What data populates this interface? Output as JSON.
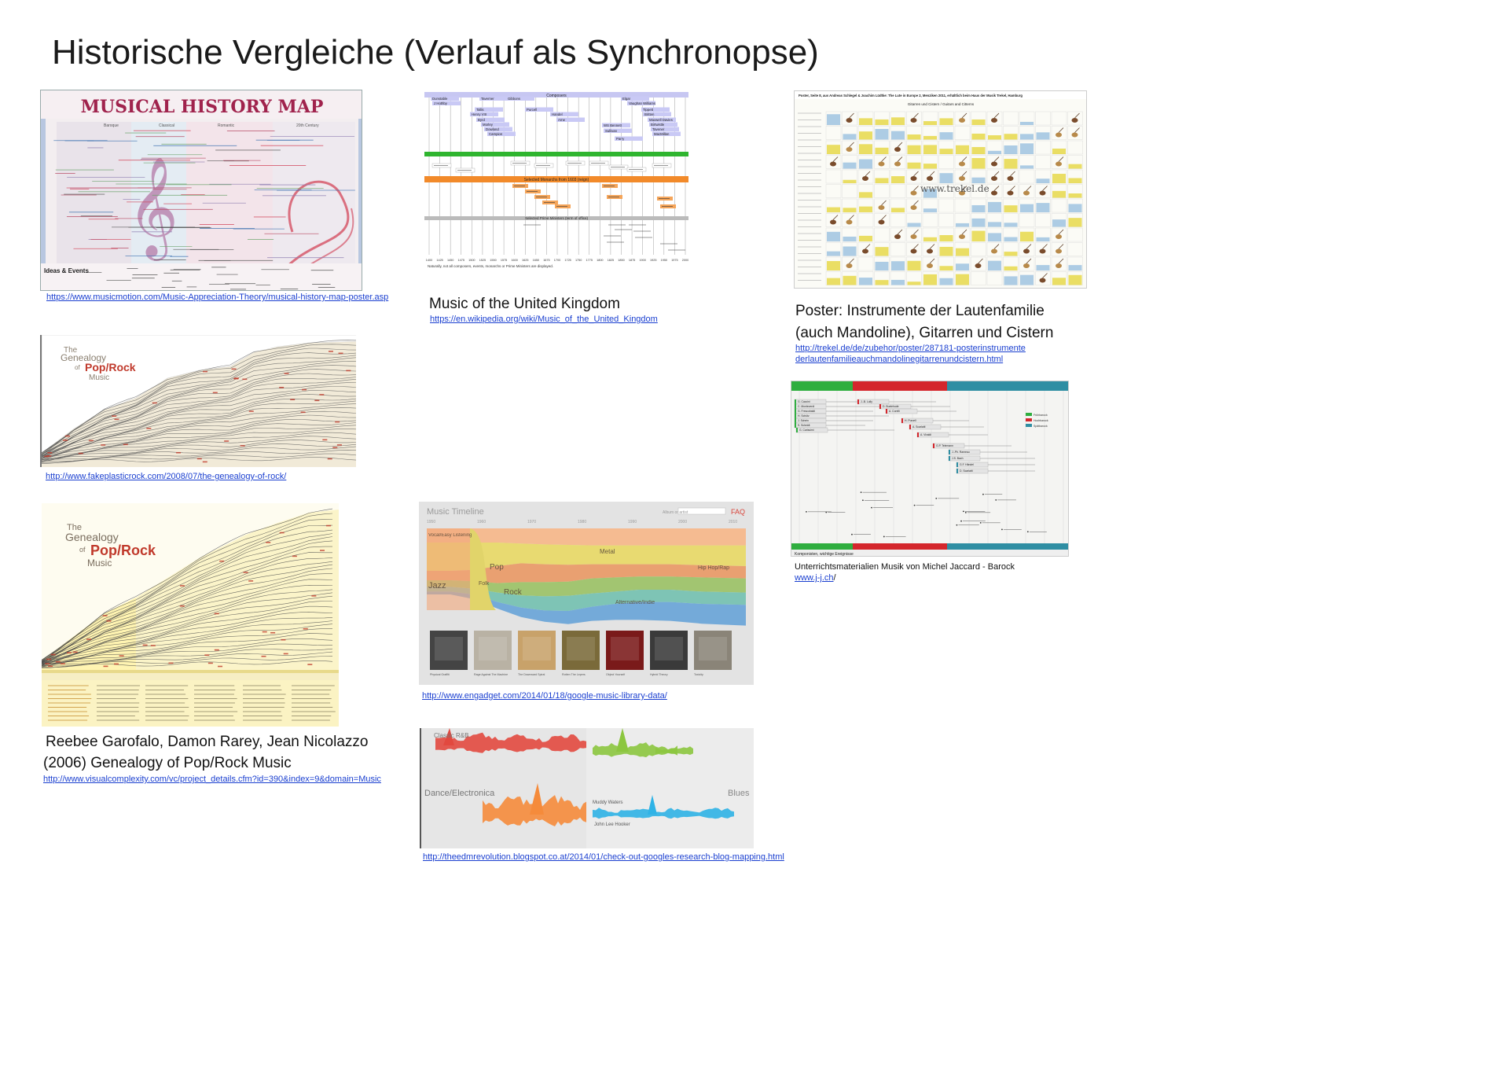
{
  "page": {
    "title": "Historische Vergleiche (Verlauf als Synchronopse)"
  },
  "items": {
    "musical_history_map": {
      "poster_title": "MUSICAL HISTORY MAP",
      "eras": [
        "Baroque",
        "Classical",
        "Romantic",
        "20th Century"
      ],
      "ideas_label": "Ideas & Events",
      "link": "https://www.musicmotion.com/Music-Appreciation-Theory/musical-history-map-poster.asp"
    },
    "music_uk": {
      "header_composers": "Composers",
      "header_monarchs": "Selected Monarchs from 1603 (reign)",
      "header_ministers": "Selected Prime Ministers (term of office)",
      "composers": [
        "Dunstable",
        "J Hothby",
        "Taverner",
        "Tallis",
        "Henry VIII",
        "Byrd",
        "Morley",
        "Dowland",
        "Campion",
        "Gibbons",
        "Purcell",
        "Handel",
        "Arne",
        "Elgar",
        "Vaughan Williams",
        "Tippett",
        "Britten",
        "Maxwell Davies",
        "Birtwistle",
        "Tavener",
        "MacMillan",
        "Sullivan",
        "Parry",
        "WS Bennett"
      ],
      "axis_years": [
        "1400",
        "1425",
        "1450",
        "1475",
        "1500",
        "1525",
        "1550",
        "1575",
        "1600",
        "1625",
        "1650",
        "1675",
        "1700",
        "1725",
        "1750",
        "1775",
        "1800",
        "1825",
        "1850",
        "1875",
        "1900",
        "1925",
        "1950",
        "1975",
        "2000"
      ],
      "footnote": "Naturally, not all composers, events, monarchs or Prime Ministers are displayed.",
      "caption": "Music of the United Kingdom",
      "link": "https://en.wikipedia.org/wiki/Music_of_the_United_Kingdom"
    },
    "lutes_poster": {
      "header": "Poster, Seite 8, aus Andreas Schlegel & Joachim Lüdtke: The Lute in Europe 2, Menziken 2011, erhältlich beim Haus der Musik Trekel, Hamburg",
      "subheader": "Gitarren und Cistern / Guitars and Citterns",
      "watermark": "www.trekel.de",
      "caption_line1": "Poster: Instrumente der Lautenfamilie",
      "caption_line2": "(auch Mandoline), Gitarren und Cistern",
      "link_line1": "http://trekel.de/de/zubehor/poster/287181-posterinstrumente",
      "link_line2": "derlautenfamilieauchmandolinegitarrenundcistern.html"
    },
    "genealogy_small": {
      "title_the": "The",
      "title_genealogy": "Genealogy",
      "title_of": "of",
      "title_poprock": "Pop/Rock",
      "title_music": "Music",
      "link": "http://www.fakeplasticrock.com/2008/07/the-genealogy-of-rock/"
    },
    "genealogy_large": {
      "title_the": "The",
      "title_genealogy": "Genealogy",
      "title_of": "of",
      "title_poprock": "Pop/Rock",
      "title_music": "Music",
      "caption_line1": "Reebee Garofalo, Damon Rarey, Jean Nicolazzo",
      "caption_line2": "(2006) Genealogy of Pop/Rock Music",
      "link": "http://www.visualcomplexity.com/vc/project_details.cfm?id=390&index=9&domain=Music"
    },
    "music_timeline": {
      "title": "Music Timeline",
      "search_label": "Album or artist",
      "faq": "FAQ",
      "decades": [
        "1950",
        "1960",
        "1970",
        "1980",
        "1990",
        "2000",
        "2010"
      ],
      "genres": [
        "Vocal/Easy Listening",
        "Pop",
        "Jazz",
        "Folk",
        "Rock",
        "Metal",
        "Hip Hop/Rap",
        "Alternative/Indie"
      ],
      "albums": [
        "Physical Graffiti",
        "Rage Against The Machine",
        "The Downward Spiral",
        "Rotten The Lepers",
        "Object Yourself",
        "Hybrid Theory",
        "Toxicity"
      ],
      "link": "http://www.engadget.com/2014/01/18/google-music-library-data/"
    },
    "research_blog": {
      "labels": [
        "Classic R&B",
        "Dance/Electronica",
        "Blues",
        "Muddy Waters",
        "John Lee Hooker"
      ],
      "link": "http://theedmrevolution.blogspot.co.at/2014/01/check-out-googles-research-blog-mapping.html"
    },
    "jaccard": {
      "legend": [
        "Frühbarock",
        "Hochbarock",
        "Spätbarock"
      ],
      "composers": [
        "G. Caccini",
        "C. Monteverdi",
        "G. Frescobaldi",
        "H. Schütz",
        "J. Schein",
        "S. Scheidt",
        "G. Carissimi",
        "J.-B. Lully",
        "D. Buxtehude",
        "A. Corelli",
        "H. Purcell",
        "A. Scarlatti",
        "A. Vivaldi",
        "G.P. Telemann",
        "J.-Ph. Rameau",
        "J.S. Bach",
        "G.F. Händel",
        "D. Scarlatti"
      ],
      "footer_label": "Komponisten, wichtige Ereignisse",
      "caption": "Unterrichtsmaterialien Musik von Michel Jaccard - Barock",
      "link_prefix": "www.j-j.ch",
      "link_suffix": "/"
    }
  }
}
